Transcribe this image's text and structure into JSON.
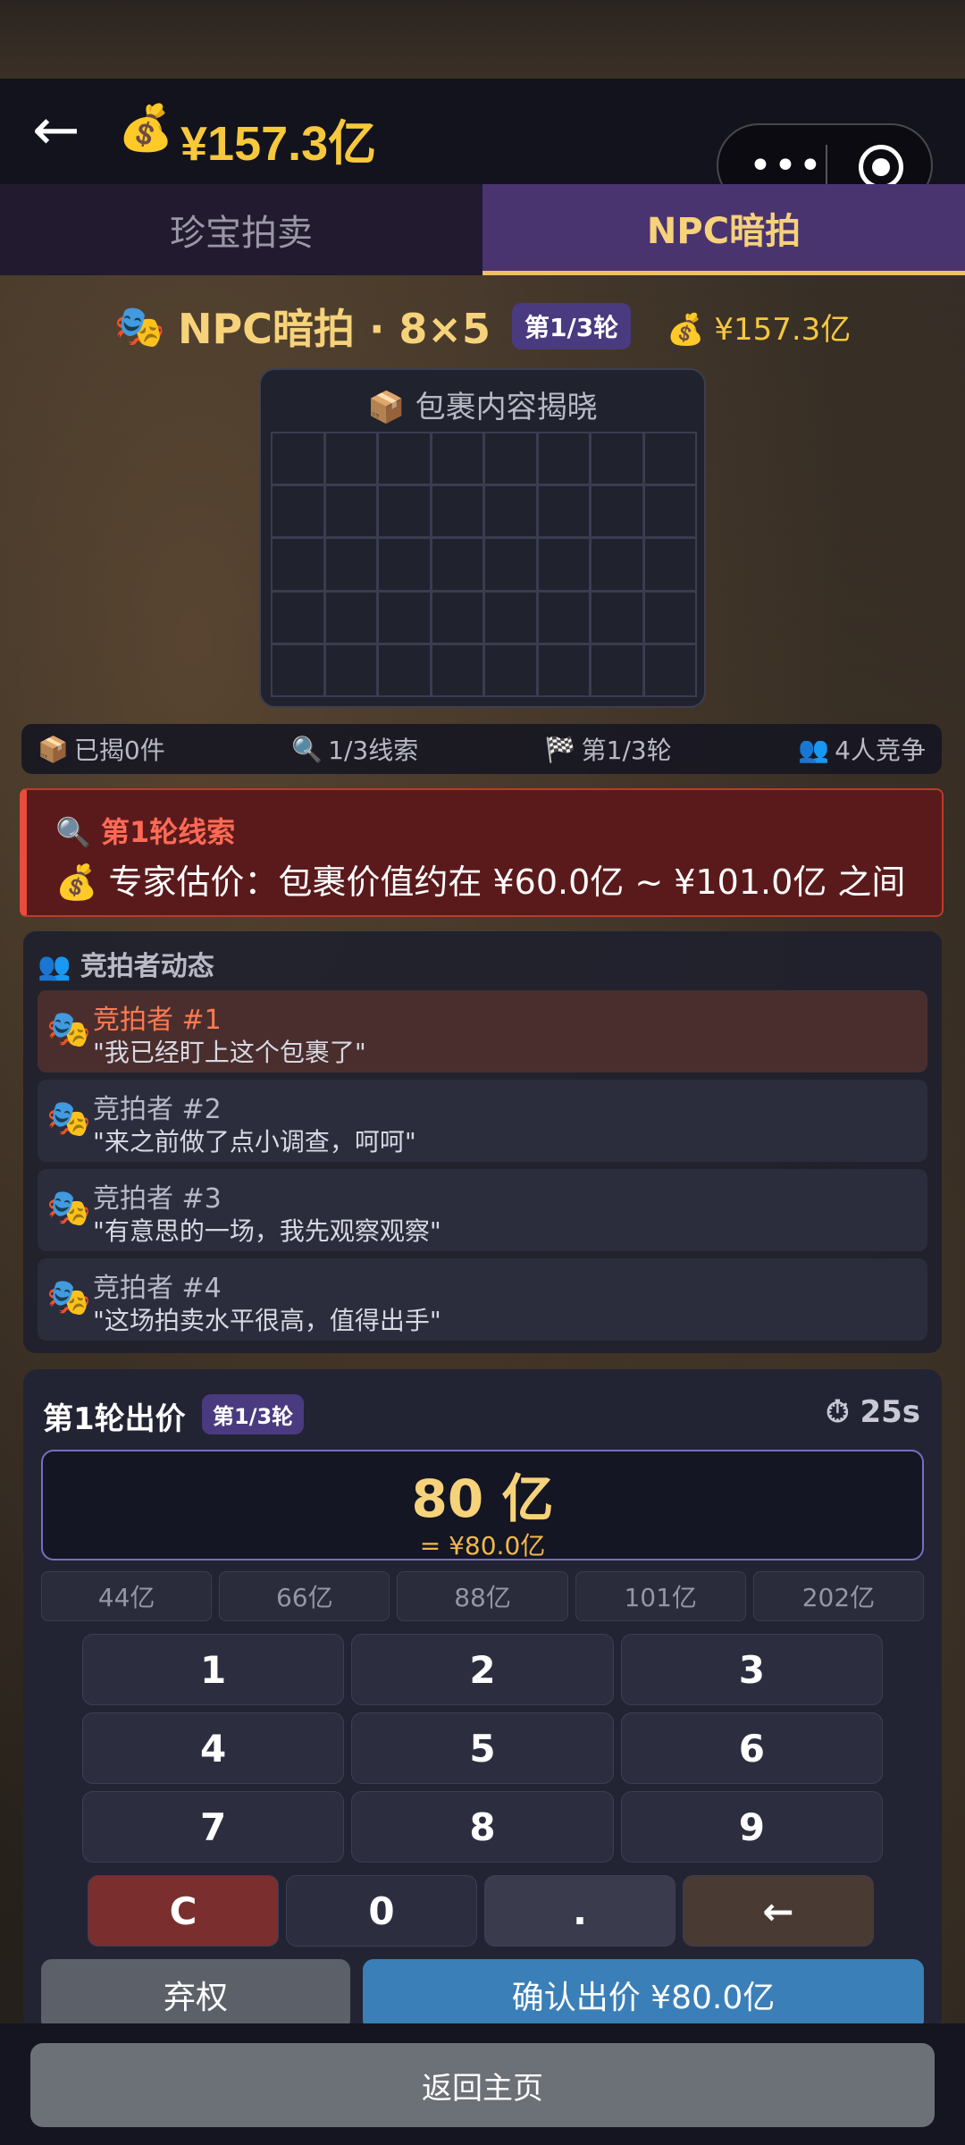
{
  "header": {
    "money": "¥157.3亿"
  },
  "tabs": [
    {
      "label": "珍宝拍卖"
    },
    {
      "label": "NPC暗拍"
    }
  ],
  "title": {
    "text": "NPC暗拍 · 8×5",
    "round_badge": "第1/3轮",
    "money": "¥157.3亿"
  },
  "reveal": {
    "title": "包裹内容揭晓"
  },
  "stats": {
    "revealed": "已揭0件",
    "clues": "1/3线索",
    "round": "第1/3轮",
    "competitors": "4人竞争"
  },
  "clue": {
    "title": "第1轮线索",
    "text": "专家估价：包裹价值约在 ¥60.0亿 ~ ¥101.0亿 之间"
  },
  "bidders": {
    "title": "竞拍者动态",
    "items": [
      {
        "name": "竞拍者 #1",
        "quote": "\"我已经盯上这个包裹了\""
      },
      {
        "name": "竞拍者 #2",
        "quote": "\"来之前做了点小调查，呵呵\""
      },
      {
        "name": "竞拍者 #3",
        "quote": "\"有意思的一场，我先观察观察\""
      },
      {
        "name": "竞拍者 #4",
        "quote": "\"这场拍卖水平很高，值得出手\""
      }
    ]
  },
  "bid": {
    "title": "第1轮出价",
    "badge": "第1/3轮",
    "timer": "25s",
    "amount": "80 亿",
    "sub": "= ¥80.0亿",
    "quick": [
      "44亿",
      "66亿",
      "88亿",
      "101亿",
      "202亿"
    ],
    "keys": [
      "1",
      "2",
      "3",
      "4",
      "5",
      "6",
      "7",
      "8",
      "9"
    ],
    "key_clear": "C",
    "key_zero": "0",
    "key_dot": ".",
    "key_back": "←",
    "giveup": "弃权",
    "confirm": "确认出价 ¥80.0亿"
  },
  "footer": {
    "home": "返回主页"
  }
}
